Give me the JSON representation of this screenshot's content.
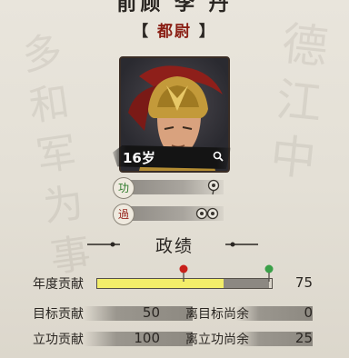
{
  "header": {
    "name": "前顾 李 丹",
    "rank": "都尉"
  },
  "portrait": {
    "age": "16岁"
  },
  "bars": [
    {
      "badge": "功"
    },
    {
      "badge": "過"
    }
  ],
  "section_title": "政绩",
  "contribution": {
    "label": "年度贡献",
    "value": "75",
    "progress": 0.73,
    "target": 0.5
  },
  "stats": [
    {
      "label": "目标贡献",
      "value": "50"
    },
    {
      "label": "离目标尚余",
      "value": "0"
    },
    {
      "label": "立功贡献",
      "value": "100"
    },
    {
      "label": "离立功尚余",
      "value": "25"
    }
  ],
  "colors": {
    "rank": "#8a1e14",
    "progress_fill": "#f3ee6a",
    "progress_done": "#8c8882"
  }
}
